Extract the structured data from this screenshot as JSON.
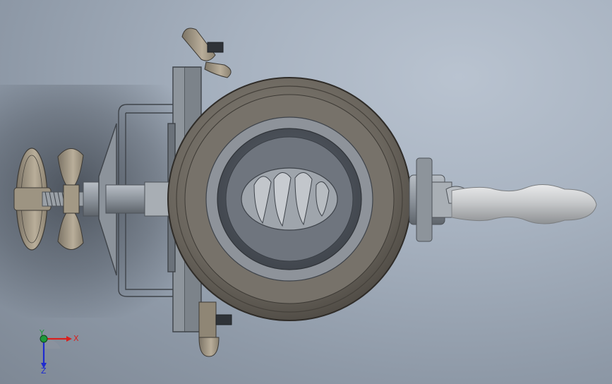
{
  "viewport": {
    "background_top": "#b9c3d0",
    "background_bottom": "#7e8895"
  },
  "triad": {
    "x_label": "X",
    "y_label": "Y",
    "z_label": "Z",
    "x_color": "#d9201e",
    "y_color": "#1f9a3a",
    "z_color": "#1e2bd0"
  },
  "model": {
    "parts": [
      "rear-wing-knob",
      "clamp-screw",
      "clamp-frame",
      "top-wing-nut",
      "bottom-wing-nut",
      "hopper-bowl",
      "feed-screw",
      "crank-hub",
      "crank-handle"
    ],
    "colors": {
      "bowl_outer": "#5e5a54",
      "bowl_inner": "#8a857d",
      "metal": "#9fa6ae",
      "metal_dark": "#5f656c",
      "handle": "#c9cbcd"
    }
  }
}
